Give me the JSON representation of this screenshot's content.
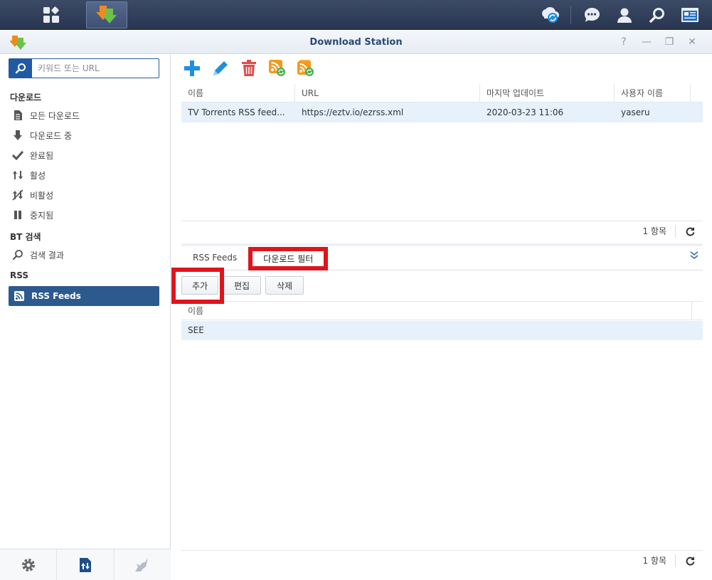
{
  "app": {
    "title": "Download Station",
    "icon": "download-station-icon"
  },
  "taskbar": {
    "left_icons": [
      "main-menu-icon",
      "download-station-icon"
    ],
    "right_icons": [
      "cloud-sync-icon",
      "chat-icon",
      "user-icon",
      "search-icon",
      "widgets-icon"
    ]
  },
  "window_controls": [
    "help-icon",
    "minimize-icon",
    "restore-icon",
    "close-icon"
  ],
  "search": {
    "placeholder": "키워드 또는 URL",
    "value": ""
  },
  "sidebar": {
    "groups": [
      {
        "label": "다운로드",
        "items": [
          {
            "label": "모든 다운로드",
            "icon": "document-icon"
          },
          {
            "label": "다운로드 중",
            "icon": "arrow-down-icon"
          },
          {
            "label": "완료됨",
            "icon": "check-icon"
          },
          {
            "label": "활성",
            "icon": "up-down-arrows-icon"
          },
          {
            "label": "비활성",
            "icon": "inactive-arrows-icon"
          },
          {
            "label": "중지됨",
            "icon": "pause-icon"
          }
        ]
      },
      {
        "label": "BT 검색",
        "items": [
          {
            "label": "검색 결과",
            "icon": "search-icon"
          }
        ]
      },
      {
        "label": "RSS",
        "items": [
          {
            "label": "RSS Feeds",
            "icon": "rss-icon",
            "active": true
          }
        ]
      }
    ],
    "bottom_icons": [
      "settings-gear-icon",
      "transfer-icon",
      "unicorn-icon"
    ]
  },
  "toolbar": {
    "icons": [
      "add-icon",
      "edit-pencil-icon",
      "delete-trash-icon",
      "rss-refresh-icon",
      "rss-refresh-all-icon"
    ]
  },
  "feeds_table": {
    "columns": [
      "이름",
      "URL",
      "마지막 업데이트",
      "사용자 이름"
    ],
    "rows": [
      [
        "TV Torrents RSS feed...",
        "https://eztv.io/ezrss.xml",
        "2020-03-23 11:06",
        "yaseru"
      ]
    ],
    "footer_count": "1 항목"
  },
  "tabs": [
    {
      "label": "RSS Feeds",
      "active": false
    },
    {
      "label": "다운로드 필터",
      "active": true
    }
  ],
  "filter_buttons": {
    "add": "추가",
    "edit": "편집",
    "delete": "삭제"
  },
  "filter_table": {
    "columns": [
      "이름"
    ],
    "rows": [
      [
        "SEE"
      ]
    ],
    "footer_count": "1 항목"
  },
  "colors": {
    "highlight": "#e0141c",
    "accent": "#2c5a8f",
    "row_selected": "#e6f1fb"
  }
}
